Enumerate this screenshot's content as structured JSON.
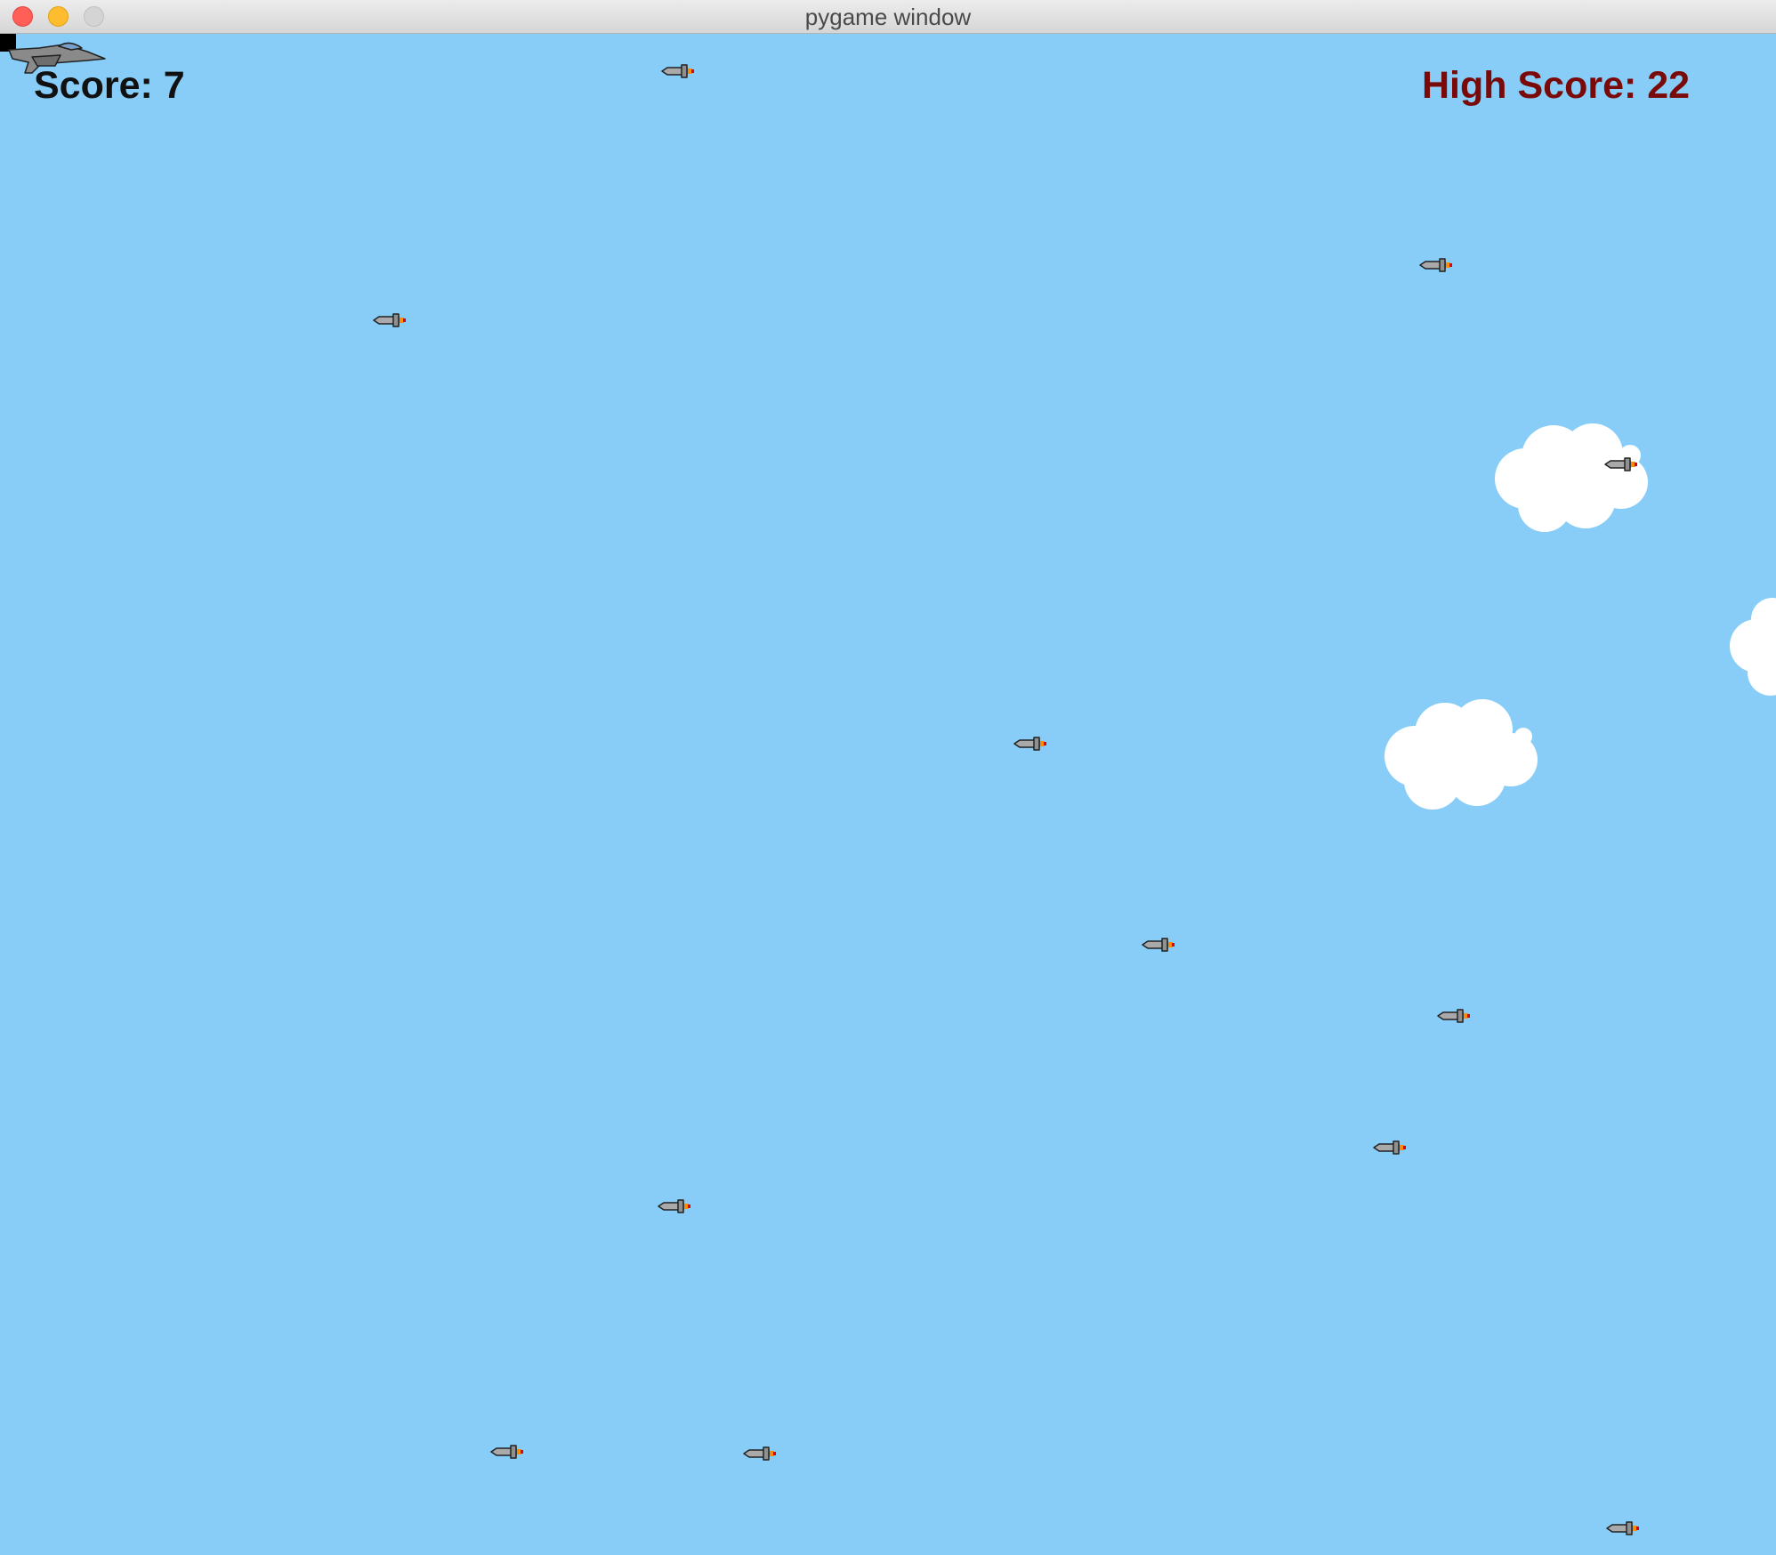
{
  "window": {
    "title": "pygame window"
  },
  "hud": {
    "score": "Score: 7",
    "high_score": "High Score: 22"
  },
  "colors": {
    "sky": "#87cdf7",
    "score_text": "#111111",
    "high_score_text": "#7a0a0a",
    "cloud": "#ffffff",
    "missile_body": "#a9a9a9",
    "missile_flame": "#ff8c00"
  },
  "icons": {
    "player": "jet-plane",
    "enemy": "missile",
    "scenery": "cloud"
  }
}
